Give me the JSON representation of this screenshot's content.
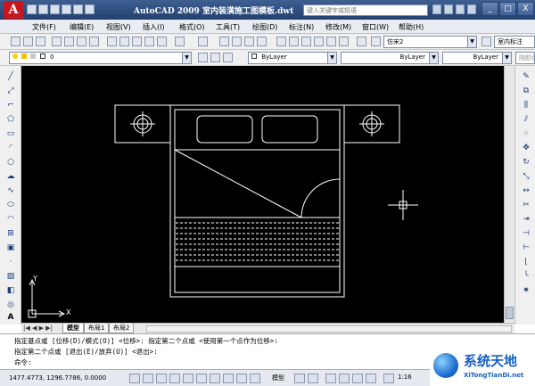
{
  "window": {
    "logo": "A",
    "title": "AutoCAD 2009  室内装潢施工图模板.dwt",
    "search_placeholder": "键入关键字或短语",
    "minimize": "_",
    "maximize": "□",
    "close": "X"
  },
  "menu": [
    "文件(F)",
    "编辑(E)",
    "视图(V)",
    "插入(I)",
    "格式(O)",
    "工具(T)",
    "绘图(D)",
    "标注(N)",
    "修改(M)",
    "窗口(W)",
    "帮助(H)"
  ],
  "toolbar": {
    "text_style": "仿宋2",
    "dim_style": "室内标注"
  },
  "properties": {
    "layer": "0",
    "color": "ByLayer",
    "linetype": "ByLayer",
    "lineweight": "ByLayer",
    "plot_style": "随颜色"
  },
  "canvas": {
    "ucs_x": "X",
    "ucs_y": "Y"
  },
  "layout_tabs": [
    "模型",
    "布局1",
    "布局2"
  ],
  "command_lines": [
    "指定基点或 [位移(D)/模式(O)] <位移>: 指定第二个点或 <使用第一个点作为位移>:",
    "指定第二个点或 [退出(E)/放弃(U)] <退出>:",
    "命令:"
  ],
  "status": {
    "coordinates": "1477.4773, 1296.7786, 0.0000",
    "model_label": "模型",
    "scale": "1:16"
  },
  "watermark": {
    "title": "系统天地",
    "url": "XiTongTianDi.net"
  },
  "colors": {
    "canvas": "#000000",
    "drawing_lines": "#ffffff",
    "title_bar": "#2f4f82",
    "watermark": "#1560c5"
  }
}
